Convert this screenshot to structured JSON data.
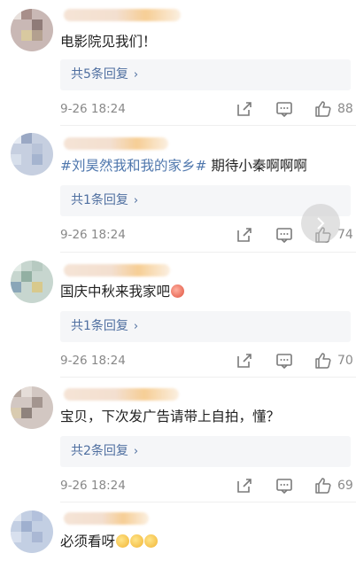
{
  "comments": [
    {
      "text": "电影院见我们！",
      "reply_label": "共5条回复",
      "time": "9-26 18:24",
      "likes": "88"
    },
    {
      "topic": "#刘昊然我和我的家乡#",
      "text": " 期待小秦啊啊啊",
      "reply_label": "共1条回复",
      "time": "9-26 18:24",
      "likes": "74"
    },
    {
      "text": "国庆中秋来我家吧",
      "reply_label": "共1条回复",
      "time": "9-26 18:24",
      "likes": "70"
    },
    {
      "text": "宝贝，下次发广告请带上自拍，懂？",
      "reply_label": "共2条回复",
      "time": "9-26 18:24",
      "likes": "69"
    },
    {
      "text": "必须看呀"
    }
  ],
  "icons": {
    "share": "share-icon",
    "comment": "comment-icon",
    "like": "thumbs-up-icon",
    "reply_arrow": "chevron-right-icon",
    "float": "chevron-right-icon"
  },
  "colors": {
    "link": "#4f6fa0",
    "topic": "#4f77ad",
    "meta": "#888888",
    "reply_bg": "#f5f6f8"
  }
}
